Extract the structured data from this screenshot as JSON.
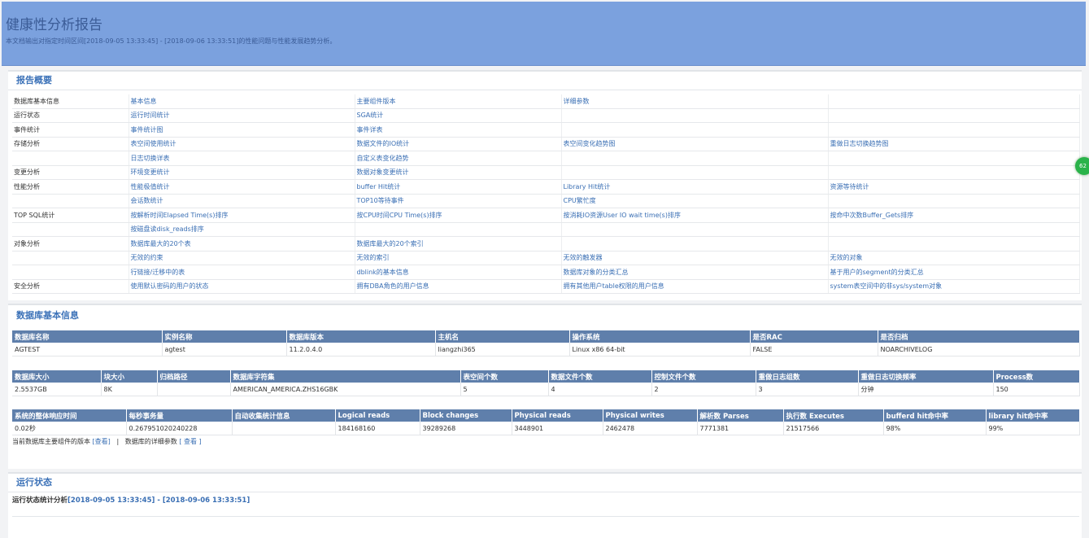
{
  "header": {
    "title": "健康性分析报告",
    "description": "本文档输出对指定时间区间[2018-09-05 13:33:45] - [2018-09-06 13:33:51]的性能问题与性能发展趋势分析。"
  },
  "overview": {
    "title": "报告概要",
    "rows": [
      {
        "category": "数据库基本信息",
        "links": [
          "基本信息",
          "主要组件版本",
          "详细参数",
          ""
        ]
      },
      {
        "category": "运行状态",
        "links": [
          "运行时间统计",
          "SGA统计",
          "",
          ""
        ]
      },
      {
        "category": "事件统计",
        "links": [
          "事件统计图",
          "事件详表",
          "",
          ""
        ]
      },
      {
        "category": "存储分析",
        "links": [
          "表空间使用统计",
          "数据文件的IO统计",
          "表空间变化趋势图",
          "重做日志切换趋势图"
        ]
      },
      {
        "category": "",
        "links": [
          "日志切换详表",
          "自定义表变化趋势",
          "",
          ""
        ]
      },
      {
        "category": "变更分析",
        "links": [
          "环境变更统计",
          "数据对象变更统计",
          "",
          ""
        ]
      },
      {
        "category": "性能分析",
        "links": [
          "性能极值统计",
          "buffer Hit统计",
          "Library Hit统计",
          "资源等待统计"
        ]
      },
      {
        "category": "",
        "links": [
          "会话数统计",
          "TOP10等待事件",
          "CPU繁忙度",
          ""
        ]
      },
      {
        "category": "TOP SQL统计",
        "links": [
          "按解析时间Elapsed Time(s)排序",
          "按CPU时间CPU Time(s)排序",
          "按消耗IO资源User IO wait time(s)排序",
          "按命中次数Buffer_Gets排序"
        ]
      },
      {
        "category": "",
        "links": [
          "按磁盘读disk_reads排序",
          "",
          "",
          ""
        ]
      },
      {
        "category": "对象分析",
        "links": [
          "数据库最大的20个表",
          "数据库最大的20个索引",
          "",
          ""
        ]
      },
      {
        "category": "",
        "links": [
          "无效的约束",
          "无效的索引",
          "无效的触发器",
          "无效的对象"
        ]
      },
      {
        "category": "",
        "links": [
          "行链接/迁移中的表",
          "dblink的基本信息",
          "数据库对象的分类汇总",
          "基于用户的segment的分类汇总"
        ]
      },
      {
        "category": "安全分析",
        "links": [
          "使用默认密码的用户的状态",
          "拥有DBA角色的用户信息",
          "拥有其他用户table权限的用户信息",
          "system表空间中的非sys/system对象"
        ]
      }
    ]
  },
  "basic_info": {
    "title": "数据库基本信息",
    "table1": {
      "headers": [
        "数据库名称",
        "实例名称",
        "数据库版本",
        "主机名",
        "操作系统",
        "是否RAC",
        "是否归档"
      ],
      "values": [
        "AGTEST",
        "agtest",
        "11.2.0.4.0",
        "liangzhi365",
        "Linux x86 64-bit",
        "FALSE",
        "NOARCHIVELOG"
      ]
    },
    "table2": {
      "headers": [
        "数据库大小",
        "块大小",
        "归档路径",
        "数据库字符集",
        "表空间个数",
        "数据文件个数",
        "控制文件个数",
        "重做日志组数",
        "重做日志切换频率",
        "Process数"
      ],
      "values": [
        "2.5537GB",
        "8K",
        "",
        "AMERICAN_AMERICA.ZHS16GBK",
        "5",
        "4",
        "2",
        "3",
        "分钟",
        "150"
      ]
    },
    "table3": {
      "headers": [
        "系统的整体响应时间",
        "每秒事务量",
        "自动收集统计信息",
        "Logical reads",
        "Block changes",
        "Physical reads",
        "Physical writes",
        "解析数 Parses",
        "执行数 Executes",
        "bufferd hit命中率",
        "library hit命中率"
      ],
      "values": [
        "0.02秒",
        "0.267951020240228",
        "",
        "184168160",
        "39289268",
        "3448901",
        "2462478",
        "7771381",
        "21517566",
        "98%",
        "99%"
      ]
    },
    "footer": {
      "component_text": "当前数据库主要组件的版本",
      "component_link": "[查看]",
      "separator": "|",
      "param_text": "数据库的详细参数",
      "param_link": "[ 查看 ]"
    }
  },
  "runtime": {
    "title": "运行状态",
    "subtitle_prefix": "运行状态统计分析",
    "subtitle_range": "[2018-09-05 13:33:45] - [2018-09-06 13:33:51]"
  },
  "float_badge": {
    "text": "62"
  }
}
